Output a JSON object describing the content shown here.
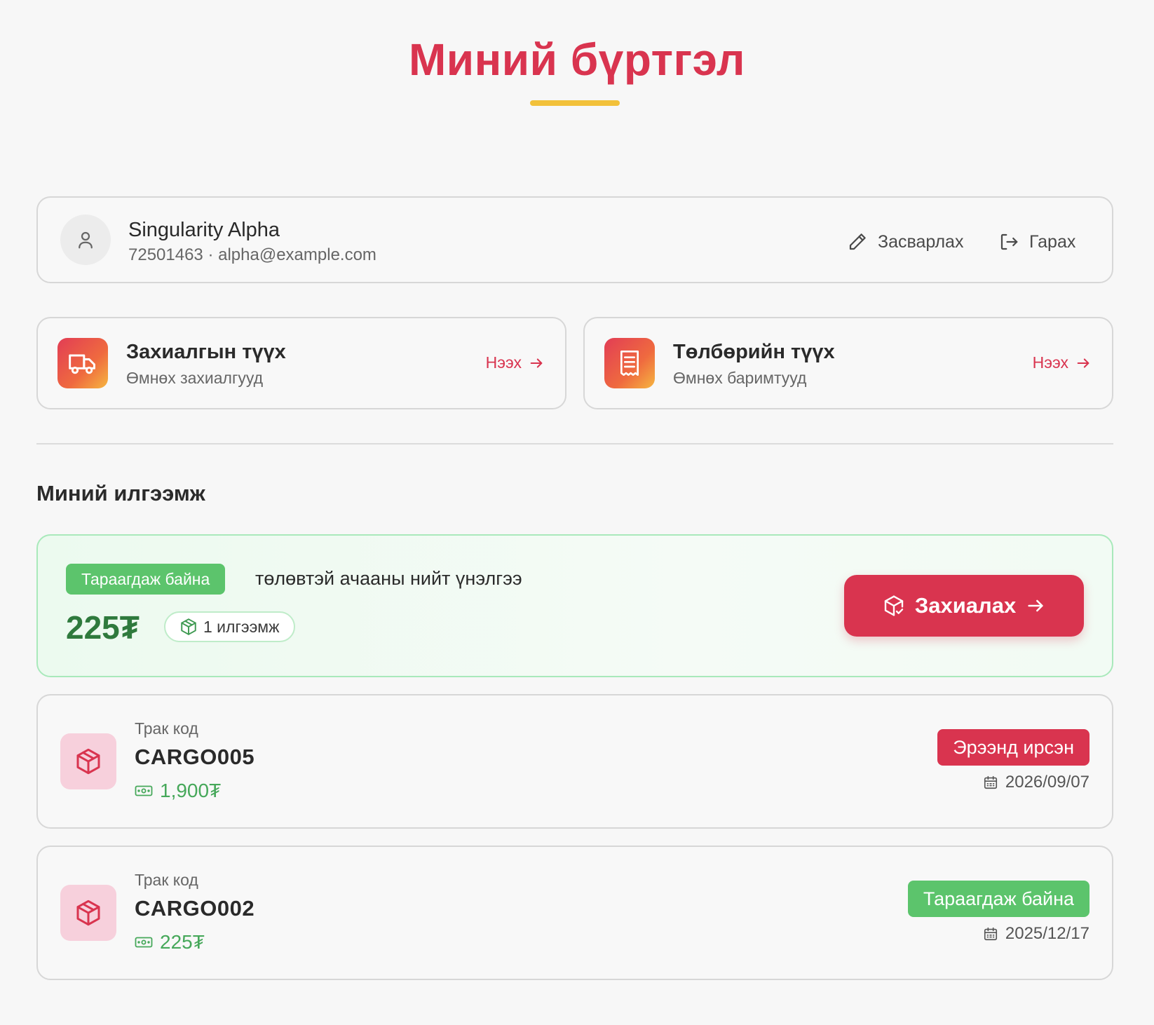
{
  "page": {
    "title": "Миний бүртгэл"
  },
  "colors": {
    "accent": "#d9344f",
    "underline": "#f2c13a",
    "success": "#5cc46c",
    "amount_green": "#2f7a3d"
  },
  "profile": {
    "name": "Singularity Alpha",
    "contact": "72501463 · alpha@example.com",
    "edit_label": "Засварлах",
    "logout_label": "Гарах",
    "avatar_icon": "user-icon"
  },
  "history": [
    {
      "title": "Захиалгын түүх",
      "subtitle": "Өмнөх захиалгууд",
      "link": "Нээх",
      "icon": "truck-icon"
    },
    {
      "title": "Төлбөрийн түүх",
      "subtitle": "Өмнөх баримтууд",
      "link": "Нээх",
      "icon": "receipt-icon"
    }
  ],
  "shipments": {
    "title": "Миний илгээмж",
    "summary": {
      "status": "Тараагдаж байна",
      "text": "төлөвтэй ачааны нийт үнэлгээ",
      "amount": "225₮",
      "count": "1 илгээмж",
      "order_label": "Захиалах"
    },
    "items": [
      {
        "label": "Трак код",
        "code": "CARGO005",
        "price": "1,900₮",
        "status": "Эрээнд ирсэн",
        "status_color": "#d9344f",
        "date": "2026/09/07"
      },
      {
        "label": "Трак код",
        "code": "CARGO002",
        "price": "225₮",
        "status": "Тараагдаж байна",
        "status_color": "#5cc46c",
        "date": "2025/12/17"
      }
    ]
  }
}
